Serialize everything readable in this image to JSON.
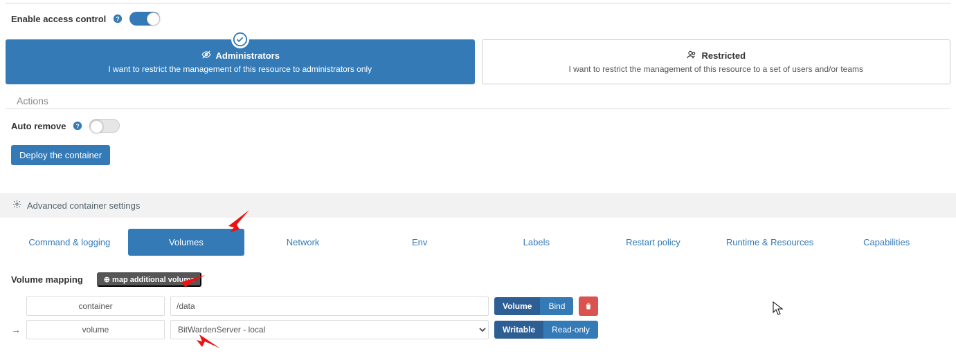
{
  "accessControl": {
    "label": "Enable access control",
    "cards": {
      "admin": {
        "title": "Administrators",
        "desc": "I want to restrict the management of this resource to administrators only"
      },
      "restricted": {
        "title": "Restricted",
        "desc": "I want to restrict the management of this resource to a set of users and/or teams"
      }
    }
  },
  "actions": {
    "header": "Actions",
    "autoRemove": "Auto remove",
    "deploy": "Deploy the container"
  },
  "advanced": {
    "title": "Advanced container settings"
  },
  "tabs": [
    "Command & logging",
    "Volumes",
    "Network",
    "Env",
    "Labels",
    "Restart policy",
    "Runtime & Resources",
    "Capabilities"
  ],
  "volumes": {
    "heading": "Volume mapping",
    "addBtn": "map additional volume",
    "row1": {
      "label": "container",
      "value": "/data",
      "segA": "Volume",
      "segB": "Bind"
    },
    "row2": {
      "label": "volume",
      "selected": "BitWardenServer - local",
      "segA": "Writable",
      "segB": "Read-only"
    }
  }
}
